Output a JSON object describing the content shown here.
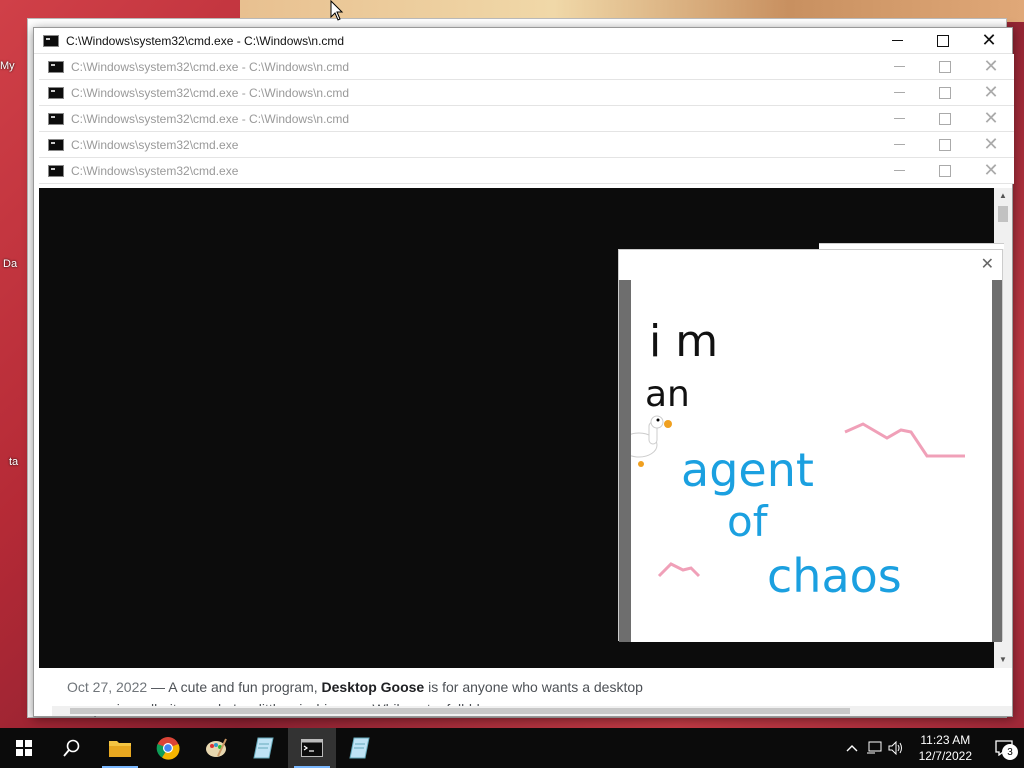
{
  "desktop": {
    "labels": [
      "My",
      "Da",
      "ta"
    ]
  },
  "cmd_windows": [
    {
      "title": "C:\\Windows\\system32\\cmd.exe - C:\\Windows\\n.cmd",
      "active": true
    },
    {
      "title": "C:\\Windows\\system32\\cmd.exe - C:\\Windows\\n.cmd",
      "active": false
    },
    {
      "title": "C:\\Windows\\system32\\cmd.exe - C:\\Windows\\n.cmd",
      "active": false
    },
    {
      "title": "C:\\Windows\\system32\\cmd.exe - C:\\Windows\\n.cmd",
      "active": false
    },
    {
      "title": "C:\\Windows\\system32\\cmd.exe",
      "active": false
    },
    {
      "title": "C:\\Windows\\system32\\cmd.exe",
      "active": false
    }
  ],
  "browser_snippet": {
    "date": "Oct 27, 2022",
    "sep": " — ",
    "pre": "A cute and fun program, ",
    "bold": "Desktop Goose",
    "post": " is for anyone who wants a desktop",
    "line2": "companion, albeit one who's a little mischievous. While not a full-blown ..."
  },
  "goose_note": {
    "lines_black": [
      "i m",
      "an"
    ],
    "lines_blue": [
      "agent",
      "of",
      "chaos"
    ],
    "ink_black": "#111111",
    "ink_blue": "#1ba0e0",
    "ink_pink": "#f0a0b8"
  },
  "taskbar": {
    "apps": [
      {
        "name": "start",
        "icon": "windows-icon"
      },
      {
        "name": "search",
        "icon": "search-icon"
      },
      {
        "name": "file-explorer",
        "icon": "folder-icon",
        "state": "running"
      },
      {
        "name": "chrome",
        "icon": "chrome-icon"
      },
      {
        "name": "paint",
        "icon": "paint-icon"
      },
      {
        "name": "notepad-1",
        "icon": "notepad-icon"
      },
      {
        "name": "cmd",
        "icon": "terminal-icon",
        "state": "active"
      },
      {
        "name": "notepad-2",
        "icon": "notepad-icon"
      }
    ],
    "tray": {
      "chevron": "^",
      "time": "11:23 AM",
      "date": "12/7/2022",
      "notifications": "3"
    }
  },
  "colors": {
    "taskbar_bg": "#0b0b0b",
    "terminal_bg": "#0c0c0c",
    "accent": "#7ab8ff"
  }
}
